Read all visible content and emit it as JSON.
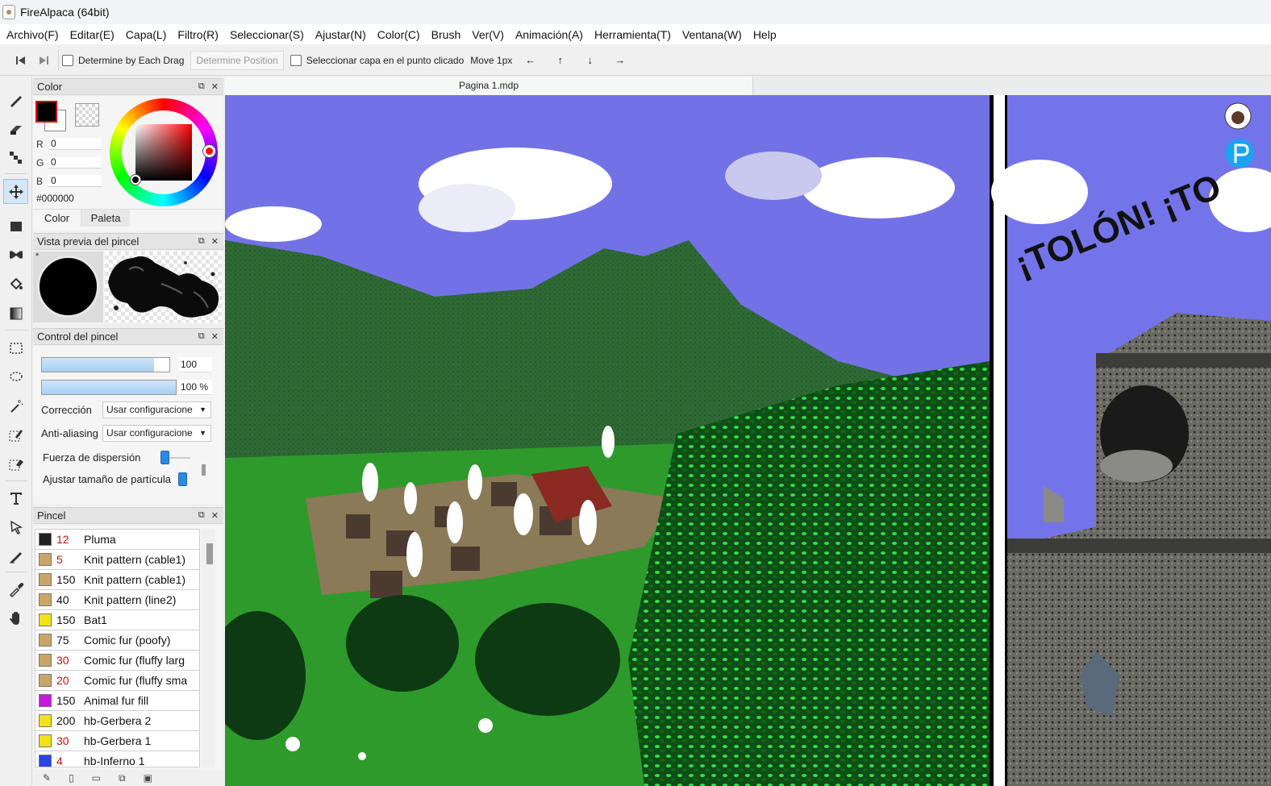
{
  "window": {
    "title": "FireAlpaca (64bit)"
  },
  "menu": [
    "Archivo(F)",
    "Editar(E)",
    "Capa(L)",
    "Filtro(R)",
    "Seleccionar(S)",
    "Ajustar(N)",
    "Color(C)",
    "Brush",
    "Ver(V)",
    "Animación(A)",
    "Herramienta(T)",
    "Ventana(W)",
    "Help"
  ],
  "toolbar": {
    "determine_drag_label": "Determine by Each Drag",
    "determine_position_label": "Determine Position",
    "select_layer_label": "Seleccionar capa en el punto clicado",
    "move_label": "Move 1px",
    "arrows": [
      "←",
      "↑",
      "↓",
      "→"
    ]
  },
  "tools": [
    {
      "name": "brush-tool-icon"
    },
    {
      "name": "eraser-tool-icon"
    },
    {
      "name": "dot-tool-icon"
    },
    {
      "name": "move-tool-icon",
      "active": true
    },
    {
      "name": "fill-rect-tool-icon"
    },
    {
      "name": "gradient-tool-icon"
    },
    {
      "name": "bucket-tool-icon"
    },
    {
      "name": "gradient-box-tool-icon"
    },
    {
      "name": "select-rect-tool-icon"
    },
    {
      "name": "lasso-tool-icon"
    },
    {
      "name": "magic-wand-tool-icon"
    },
    {
      "name": "select-pen-tool-icon"
    },
    {
      "name": "select-eraser-tool-icon"
    },
    {
      "name": "text-tool-icon"
    },
    {
      "name": "operation-tool-icon"
    },
    {
      "name": "divide-tool-icon"
    },
    {
      "name": "eyedropper-tool-icon"
    },
    {
      "name": "hand-tool-icon"
    }
  ],
  "color_panel": {
    "title": "Color",
    "r_label": "R",
    "g_label": "G",
    "b_label": "B",
    "r": "0",
    "g": "0",
    "b": "0",
    "hex": "#000000",
    "tab_color": "Color",
    "tab_palette": "Paleta"
  },
  "brush_preview_panel": {
    "title": "Vista previa del pincel",
    "marker": "*"
  },
  "brush_control_panel": {
    "title": "Control del pincel",
    "size_value": "100",
    "opacity_value": "100 %",
    "correction_label": "Corrección",
    "correction_value": "Usar configuracione",
    "antialias_label": "Anti-aliasing",
    "antialias_value": "Usar configuracione",
    "scatter_label": "Fuerza de dispersión",
    "particle_label": "Ajustar tamaño de partícula",
    "size_level": 0.88,
    "opacity_level": 1.0
  },
  "brush_panel": {
    "title": "Pincel",
    "items": [
      {
        "size": "12",
        "name": "Pluma",
        "color": "#222222",
        "size_color": "#d01010"
      },
      {
        "size": "5",
        "name": "Knit pattern (cable1)",
        "color": "#c9a56a",
        "size_color": "#d01010"
      },
      {
        "size": "150",
        "name": "Knit pattern (cable1)",
        "color": "#c9a56a",
        "size_color": "#111111"
      },
      {
        "size": "40",
        "name": "Knit pattern (line2)",
        "color": "#c9a56a",
        "size_color": "#111111"
      },
      {
        "size": "150",
        "name": "Bat1",
        "color": "#f2e21a",
        "size_color": "#111111"
      },
      {
        "size": "75",
        "name": "Comic fur (poofy)",
        "color": "#c9a56a",
        "size_color": "#111111"
      },
      {
        "size": "30",
        "name": "Comic fur (fluffy larg",
        "color": "#c9a56a",
        "size_color": "#d01010"
      },
      {
        "size": "20",
        "name": "Comic fur (fluffy sma",
        "color": "#c9a56a",
        "size_color": "#d01010"
      },
      {
        "size": "150",
        "name": "Animal fur fill",
        "color": "#c51ad6",
        "size_color": "#111111"
      },
      {
        "size": "200",
        "name": "hb-Gerbera 2",
        "color": "#f2e21a",
        "size_color": "#111111"
      },
      {
        "size": "30",
        "name": "hb-Gerbera 1",
        "color": "#f2e21a",
        "size_color": "#d01010"
      },
      {
        "size": "4",
        "name": "hb-Inferno 1",
        "color": "#2a44e6",
        "size_color": "#d01010"
      }
    ]
  },
  "document": {
    "tab_title": "Pagina 1.mdp",
    "comic_text": "¡TOLÓN! ¡TO"
  }
}
